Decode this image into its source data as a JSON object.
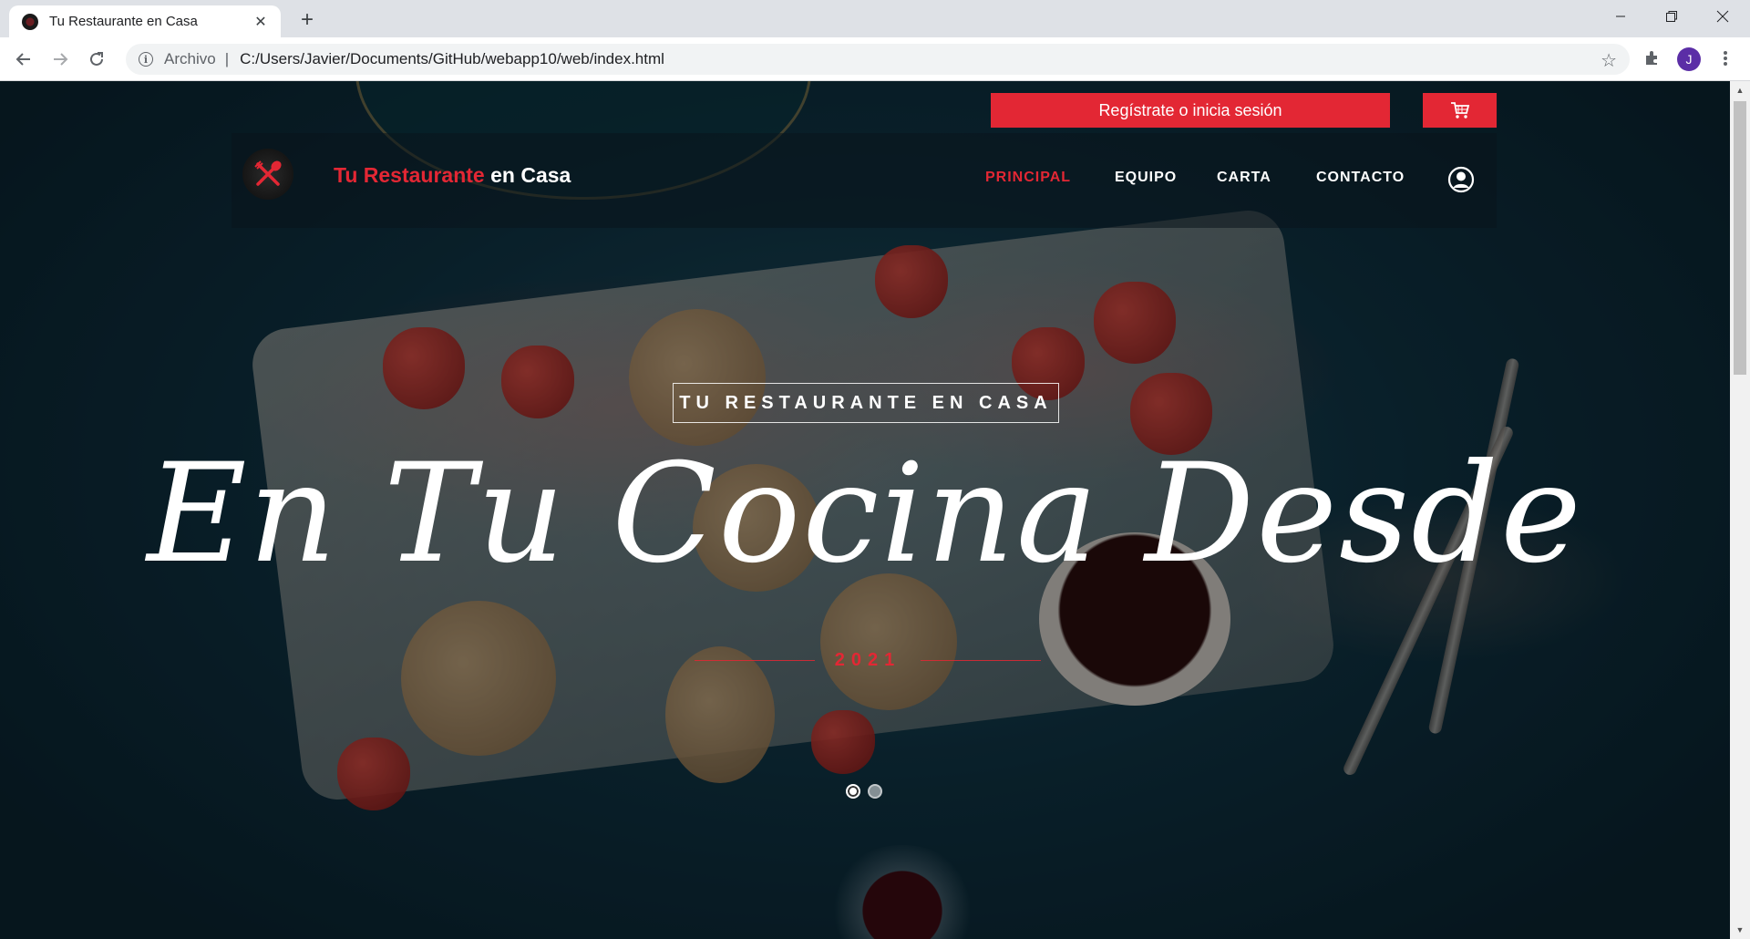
{
  "browser": {
    "tab_title": "Tu Restaurante en Casa",
    "tab_close": "✕",
    "new_tab": "+",
    "url_scheme": "Archivo",
    "url_separator": "|",
    "url": "C:/Users/Javier/Documents/GitHub/webapp10/web/index.html",
    "profile_initial": "J",
    "icons": [
      "back-icon",
      "forward-icon",
      "reload-icon",
      "info-icon",
      "star-icon",
      "extensions-icon",
      "menu-icon",
      "minimize-icon",
      "restore-icon",
      "close-icon"
    ]
  },
  "header": {
    "register_label": "Regístrate o inicia sesión",
    "brand_red": "Tu Restaurante",
    "brand_white": " en Casa",
    "nav": [
      {
        "label": "PRINCIPAL",
        "active": true
      },
      {
        "label": "EQUIPO",
        "active": false
      },
      {
        "label": "CARTA",
        "active": false
      },
      {
        "label": "CONTACTO",
        "active": false
      }
    ],
    "accent_color": "#e32734"
  },
  "hero": {
    "tag": "TU RESTAURANTE EN CASA",
    "title": "En Tu Cocina Desde",
    "year": "2021",
    "slides": 2,
    "active_slide": 1
  }
}
